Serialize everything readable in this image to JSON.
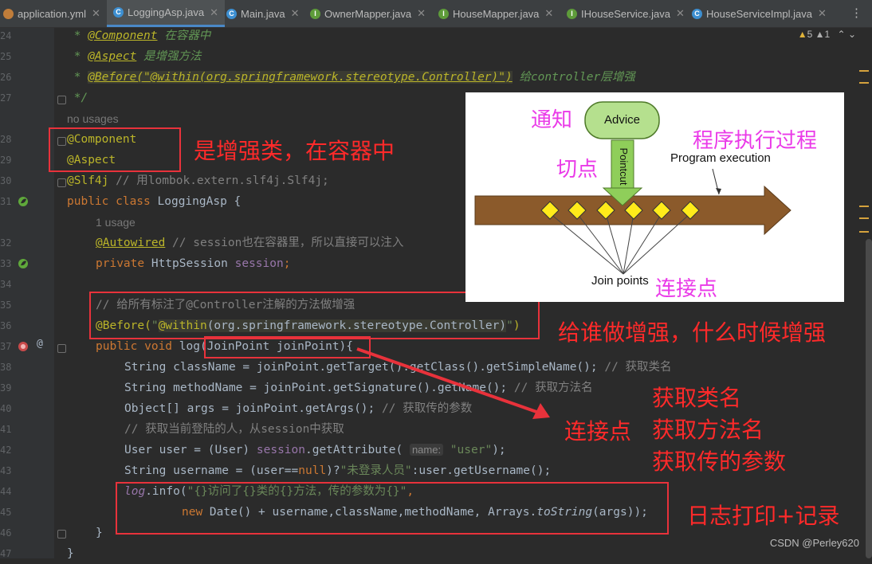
{
  "tabs": [
    {
      "label": "application.yml",
      "icon": "yml-file-icon",
      "active": false
    },
    {
      "label": "LoggingAsp.java",
      "icon": "class-icon",
      "active": true
    },
    {
      "label": "Main.java",
      "icon": "class-icon",
      "active": false
    },
    {
      "label": "OwnerMapper.java",
      "icon": "interface-icon",
      "active": false
    },
    {
      "label": "HouseMapper.java",
      "icon": "interface-icon",
      "active": false
    },
    {
      "label": "IHouseService.java",
      "icon": "interface-icon",
      "active": false
    },
    {
      "label": "HouseServiceImpl.java",
      "icon": "class-icon",
      "active": false
    }
  ],
  "inspections": {
    "warnings": "5",
    "weak_warnings": "1"
  },
  "line_numbers": [
    "24",
    "25",
    "26",
    "27",
    "28",
    "29",
    "30",
    "31",
    "32",
    "33",
    "34",
    "35",
    "36",
    "37",
    "38",
    "39",
    "40",
    "41",
    "42",
    "43",
    "44",
    "45",
    "46",
    "47"
  ],
  "code": {
    "l24_star": " * ",
    "l24_tag": "@Component",
    "l24_text": " 在容器中",
    "l25_star": " * ",
    "l25_tag": "@Aspect",
    "l25_text": " 是增强方法",
    "l26_star": " * ",
    "l26_tag": "@Before(\"@within(org.springframework.stereotype.Controller)\")",
    "l26_text": " 给controller层增强",
    "l27": " */",
    "usages0": "no usages",
    "l28": "@Component",
    "l29": "@Aspect",
    "l30_ann": "@Slf4j",
    "l30_cmt": " // 用lombok.extern.slf4j.Slf4j;",
    "l31_kw": "public class ",
    "l31_name": "LoggingAsp {",
    "usages1": "1 usage",
    "l32_ann": "@Autowired",
    "l32_cmt": " // session也在容器里，所以直接可以注入",
    "l33_kw": "private ",
    "l33_type": "HttpSession ",
    "l33_fld": "session",
    "l33_end": ";",
    "l35_cmt": "// 给所有标注了@Controller注解的方法做增强",
    "l36_ann": "@Before(",
    "l36_str1": "\"",
    "l36_str2": "@within",
    "l36_str3": "(org.springframework.stereotype.Controller)",
    "l36_str4": "\"",
    "l36_end": ")",
    "l37_kw": "public void ",
    "l37_rest": "log(JoinPoint joinPoint){",
    "l38_a": "String className = joinPoint.getTarget().getClass().getSimpleName(); ",
    "l38_c": "// 获取类名",
    "l39_a": "String methodName = joinPoint.getSignature().getName(); ",
    "l39_c": "// 获取方法名",
    "l40_a": "Object[] args = joinPoint.getArgs(); ",
    "l40_c": "// 获取传的参数",
    "l41_c": "// 获取当前登陆的人，从session中获取",
    "l42_a": "User user = (User) ",
    "l42_fld": "session",
    "l42_b": ".getAttribute( ",
    "l42_hint": "name:",
    "l42_str": " \"user\"",
    "l42_end": ");",
    "l43_a": "String username = (user==",
    "l43_kw": "null",
    "l43_b": ")?",
    "l43_str": "\"未登录人员\"",
    "l43_c": ":user.getUsername();",
    "l44_fld": "log",
    "l44_a": ".info(",
    "l44_str": "\"{}访问了{}类的{}方法，传的参数为{}\"",
    "l44_end": ",",
    "l45_kw": "new ",
    "l45_a": "Date() + username,className,methodName, Arrays.",
    "l45_it": "toString",
    "l45_b": "(args));",
    "l46": "}",
    "l47": "}"
  },
  "annotations": {
    "enhance_class": "是增强类，在容器中",
    "who_when": "给谁做增强，什么时候增强",
    "join_point": "连接点",
    "get_class": "获取类名",
    "get_method": "获取方法名",
    "get_args": "获取传的参数",
    "log_record": "日志打印+记录"
  },
  "diagram": {
    "advice_cn": "通知",
    "advice": "Advice",
    "pointcut_cn": "切点",
    "pointcut": "Pointcut",
    "program_cn": "程序执行过程",
    "program": "Program execution",
    "join_points": "Join points",
    "join_points_cn": "连接点"
  },
  "watermark": "CSDN @Perley620",
  "colors": {
    "red": "#e8323b",
    "magenta": "#ea3ae8",
    "advice_green": "#b5e08e",
    "arrow_brown": "#8b5a2b"
  }
}
